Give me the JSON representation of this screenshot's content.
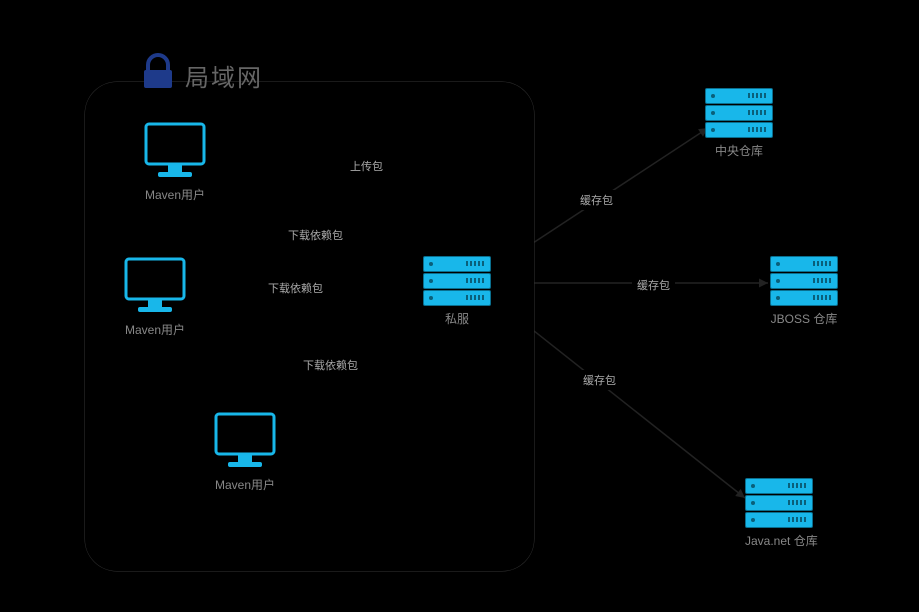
{
  "diagram": {
    "title": "局域网",
    "lock_icon": "lock-icon",
    "users": [
      {
        "label": "Maven用户"
      },
      {
        "label": "Maven用户"
      },
      {
        "label": "Maven用户"
      }
    ],
    "private_server": {
      "label": "私服"
    },
    "remote_repos": [
      {
        "label": "中央仓库"
      },
      {
        "label": "JBOSS 仓库"
      },
      {
        "label": "Java.net 仓库"
      }
    ],
    "edges": {
      "upload": "上传包",
      "download1": "下载依赖包",
      "download2": "下载依赖包",
      "download3": "下载依赖包",
      "cache1": "缓存包",
      "cache2": "缓存包",
      "cache3": "缓存包"
    }
  },
  "colors": {
    "accent": "#18b7ea",
    "line": "#222",
    "text_muted": "#888"
  }
}
